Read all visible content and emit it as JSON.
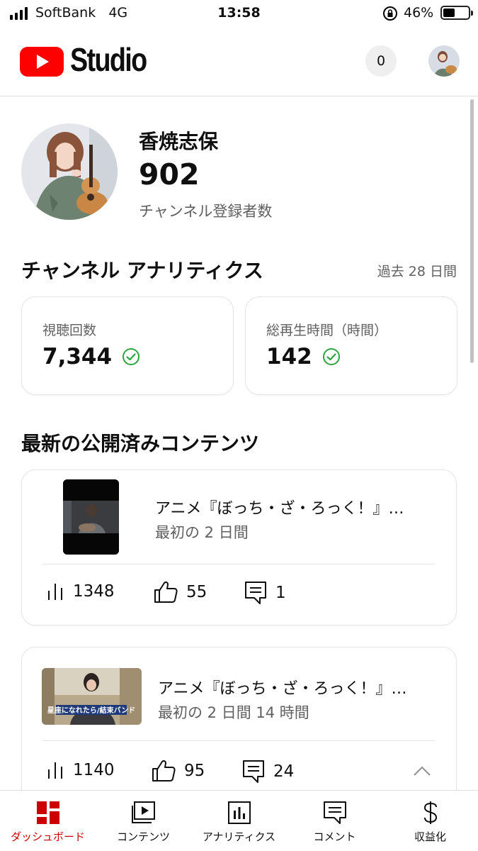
{
  "status_bar": {
    "carrier": "SoftBank",
    "network": "4G",
    "time": "13:58",
    "battery_percent": "46%",
    "battery_level": 0.46,
    "icons": [
      "signal-icon",
      "orientation-lock-icon",
      "battery-icon"
    ]
  },
  "header": {
    "logo_text": "Studio",
    "notification_count": "0",
    "brand_color": "#ff0000"
  },
  "channel": {
    "name": "香焼志保",
    "subscribers": "902",
    "subscribers_label": "チャンネル登録者数"
  },
  "analytics": {
    "title": "チャンネル アナリティクス",
    "period": "過去 28 日間",
    "cards": [
      {
        "label": "視聴回数",
        "value": "7,344"
      },
      {
        "label": "総再生時間（時間）",
        "value": "142"
      }
    ],
    "check_color": "#2ba640"
  },
  "recent": {
    "title": "最新の公開済みコンテンツ",
    "videos": [
      {
        "title": "アニメ『ぼっち・ざ・ろっく！』…",
        "subtitle": "最初の 2 日間",
        "views": "1348",
        "likes": "55",
        "comments": "1"
      },
      {
        "title": "アニメ『ぼっち・ざ・ろっく！』…",
        "subtitle": "最初の 2 日間 14 時間",
        "views": "1140",
        "likes": "95",
        "comments": "24",
        "thumbnail_text": "星座になれたら/結束バンド"
      }
    ]
  },
  "bottom_nav": {
    "items": [
      {
        "label": "ダッシュボード",
        "icon": "dashboard-icon",
        "active": true
      },
      {
        "label": "コンテンツ",
        "icon": "content-icon",
        "active": false
      },
      {
        "label": "アナリティクス",
        "icon": "analytics-icon",
        "active": false
      },
      {
        "label": "コメント",
        "icon": "comment-icon",
        "active": false
      },
      {
        "label": "収益化",
        "icon": "dollar-icon",
        "active": false
      }
    ],
    "active_color": "#cc0000"
  }
}
